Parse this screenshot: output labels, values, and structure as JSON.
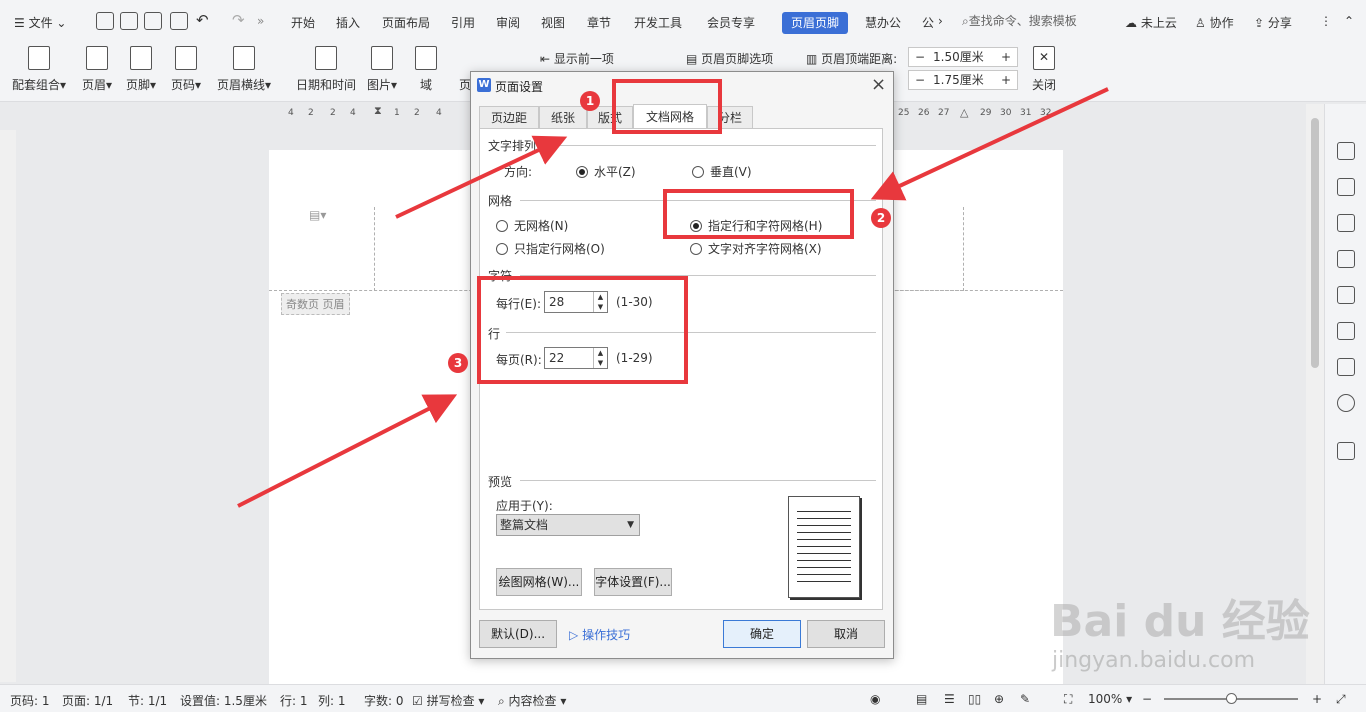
{
  "menubar": {
    "file": "文件",
    "tabs": [
      "开始",
      "插入",
      "页面布局",
      "引用",
      "审阅",
      "视图",
      "章节",
      "开发工具",
      "会员专享"
    ],
    "active_tab": "页眉页脚",
    "after_tabs": [
      "慧办公",
      "公"
    ],
    "search": "查找命令、搜索模板",
    "cloud": "未上云",
    "collab": "协作",
    "share": "分享"
  },
  "ribbon": {
    "buttons": [
      "配套组合",
      "页眉",
      "页脚",
      "页码",
      "页眉横线",
      "日期和时间",
      "图片",
      "域",
      "页"
    ],
    "show_prev": "显示前一项",
    "hf_options": "页眉页脚选项",
    "header_top_label": "页眉顶端距离:",
    "header_top_value": "1.50厘米",
    "footer_bottom_value": "1.75厘米",
    "close": "关闭"
  },
  "ruler": {
    "left_ticks": [
      "4",
      "2",
      "2",
      "4",
      "1",
      "2",
      "4"
    ],
    "right_ticks": [
      "25",
      "26",
      "27",
      "29",
      "30",
      "31",
      "32"
    ]
  },
  "document": {
    "odd_header_tag": "奇数页 页眉"
  },
  "dialog": {
    "title": "页面设置",
    "close": "×",
    "tabs": [
      "页边距",
      "纸张",
      "版式",
      "文档网格",
      "分栏"
    ],
    "active_tab": "文档网格",
    "text_direction_section": "文字排列",
    "direction_label": "方向:",
    "horizontal": "水平(Z)",
    "vertical": "垂直(V)",
    "grid_section": "网格",
    "no_grid": "无网格(N)",
    "line_only_grid": "只指定行网格(O)",
    "line_char_grid": "指定行和字符网格(H)",
    "align_char_grid": "文字对齐字符网格(X)",
    "chars_section": "字符",
    "per_line_label": "每行(E):",
    "per_line_value": "28",
    "per_line_range": "(1-30)",
    "lines_section": "行",
    "per_page_label": "每页(R):",
    "per_page_value": "22",
    "per_page_range": "(1-29)",
    "preview_section": "预览",
    "apply_to_label": "应用于(Y):",
    "apply_to_value": "整篇文档",
    "draw_grid_button": "绘图网格(W)...",
    "font_settings_button": "字体设置(F)...",
    "default_button": "默认(D)...",
    "tips_link": "操作技巧",
    "ok_button": "确定",
    "cancel_button": "取消"
  },
  "annotations": [
    "1",
    "2",
    "3"
  ],
  "statusbar": {
    "page_code": "页码: 1",
    "page": "页面: 1/1",
    "section": "节: 1/1",
    "setting": "设置值: 1.5厘米",
    "row": "行: 1",
    "col": "列: 1",
    "words": "字数: 0",
    "spell": "拼写检查",
    "content": "内容检查",
    "zoom": "100%"
  },
  "watermark": {
    "brand": "Bai du 经验",
    "url": "jingyan.baidu.com"
  },
  "colors": {
    "accent": "#3b6fd6",
    "annotation": "#e8383d"
  }
}
